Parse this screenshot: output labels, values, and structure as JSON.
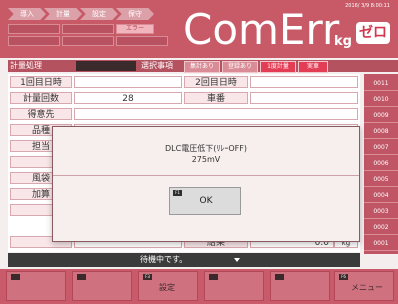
{
  "window": {
    "timestamp": "2016/ 3/9  8:00:11"
  },
  "header": {
    "crumbs": [
      "導入",
      "計量",
      "設定",
      "保守"
    ],
    "status_error_label": "エラー",
    "app_title": "ComErr",
    "unit": "kg",
    "zero_button": "ゼロ"
  },
  "mode_row": {
    "mode_label": "計量処理",
    "selection_label": "選択事項",
    "options": [
      {
        "label": "集計あり",
        "active": false
      },
      {
        "label": "登録あり",
        "active": false
      },
      {
        "label": "1度計量",
        "active": true
      },
      {
        "label": "実車",
        "active": true
      }
    ]
  },
  "form": {
    "rows": [
      {
        "label": "1回目日時",
        "value": "",
        "label2": "2回目日時",
        "value2": ""
      },
      {
        "label": "計量回数",
        "value": "28",
        "label2": "車番",
        "value2": ""
      },
      {
        "label": "得意先",
        "value": "",
        "label2": "",
        "value2": ""
      },
      {
        "label": "品種",
        "value": "",
        "label2": "",
        "value2": ""
      },
      {
        "label": "担当",
        "value": "",
        "label2": "",
        "value2": ""
      },
      {
        "label": "",
        "value": "",
        "label2": "",
        "value2": ""
      },
      {
        "label": "風袋",
        "value": "",
        "label2": "",
        "value2": ""
      },
      {
        "label": "加算",
        "value": "",
        "label2": "",
        "value2": ""
      },
      {
        "label": "",
        "value": "",
        "label2": "",
        "value2": ""
      },
      {
        "label": "",
        "value": "",
        "label2": "結果",
        "value2": "0.0"
      }
    ],
    "result_unit": "kg"
  },
  "row_numbers": [
    "0011",
    "0010",
    "0009",
    "0008",
    "0007",
    "0006",
    "0005",
    "0004",
    "0003",
    "0002",
    "0001"
  ],
  "status_bar": {
    "text": "待機中です。"
  },
  "function_keys": [
    {
      "tag": "",
      "label": ""
    },
    {
      "tag": "",
      "label": ""
    },
    {
      "tag": "F3",
      "label": "設定"
    },
    {
      "tag": "",
      "label": ""
    },
    {
      "tag": "",
      "label": ""
    },
    {
      "tag": "F6",
      "label": "メニュー"
    }
  ],
  "dialog": {
    "message_line1": "DLC電圧低下(ﾘﾚｰOFF)",
    "message_line2": "275mV",
    "ok_tag": "F1",
    "ok_label": "OK"
  }
}
